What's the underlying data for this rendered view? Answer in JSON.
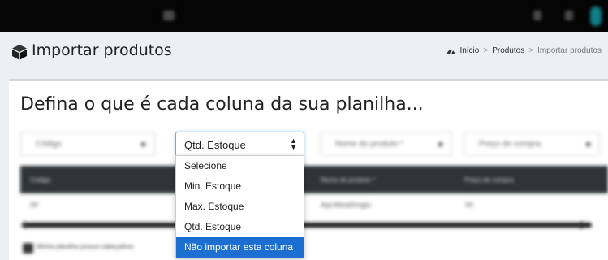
{
  "header": {
    "title": "Importar produtos",
    "breadcrumb": {
      "home": "Início",
      "parent": "Produtos",
      "current": "Importar produtos"
    }
  },
  "main": {
    "heading": "Defina o que é cada coluna da sua planilha...",
    "column_selects": [
      {
        "value": "Código"
      },
      {
        "value": "Qtd. Estoque"
      },
      {
        "value": "Nome do produto *"
      },
      {
        "value": "Preço de compra"
      }
    ],
    "table_headers": [
      "Código",
      "",
      "Nome do produto *",
      "Preço de compra"
    ],
    "table_row": [
      "00",
      "",
      "ApLMeiaDrogiu",
      "00"
    ],
    "checkbox_label": "Minha planilha possui cabeçalhos"
  },
  "dropdown": {
    "options": [
      "Selecione",
      "Min. Estoque",
      "Max. Estoque",
      "Qtd. Estoque",
      "Não importar esta coluna"
    ],
    "highlighted_index": 4
  },
  "colors": {
    "topbar": "#050505",
    "highlight": "#1c6fd1",
    "table_header": "#2e3438",
    "focus_border": "#66afe9"
  },
  "icons": [
    "cube-icon",
    "dashboard-icon",
    "select-arrows-icon"
  ]
}
